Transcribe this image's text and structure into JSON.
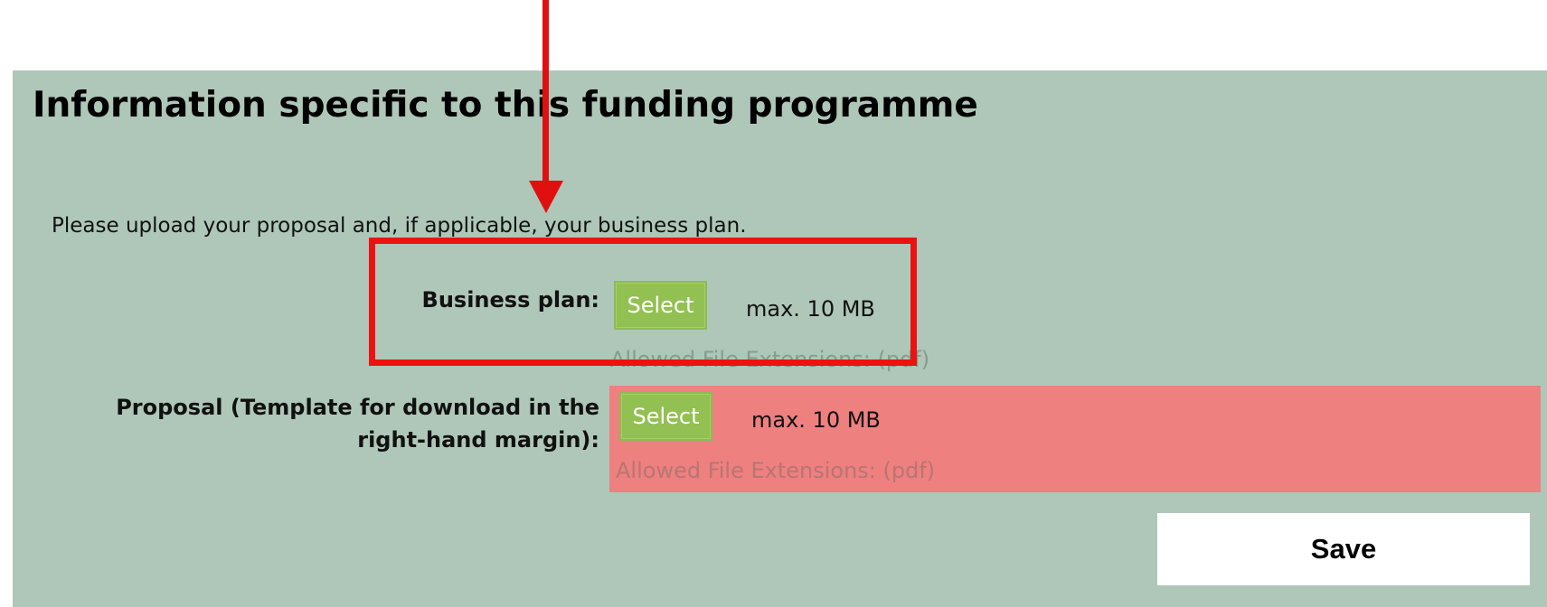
{
  "section": {
    "title": "Information specific to this funding programme",
    "instructions": "Please upload your proposal and, if applicable, your business plan."
  },
  "fields": {
    "business_plan": {
      "label": "Business plan:",
      "button": "Select",
      "max_size": "max. 10 MB",
      "allowed_extensions": "Allowed File Extensions: (pdf)"
    },
    "proposal": {
      "label_line1": "Proposal (Template for download in the",
      "label_line2": "right-hand margin):",
      "button": "Select",
      "max_size": "max. 10 MB",
      "allowed_extensions": "Allowed File Extensions: (pdf)",
      "state": "error"
    }
  },
  "actions": {
    "save_label": "Save"
  },
  "annotations": {
    "arrow_color": "#e01010",
    "highlight_color": "#ee1111"
  },
  "colors": {
    "panel_background": "#aec7b8",
    "button_green": "#92c052",
    "error_background": "#ee8080"
  }
}
